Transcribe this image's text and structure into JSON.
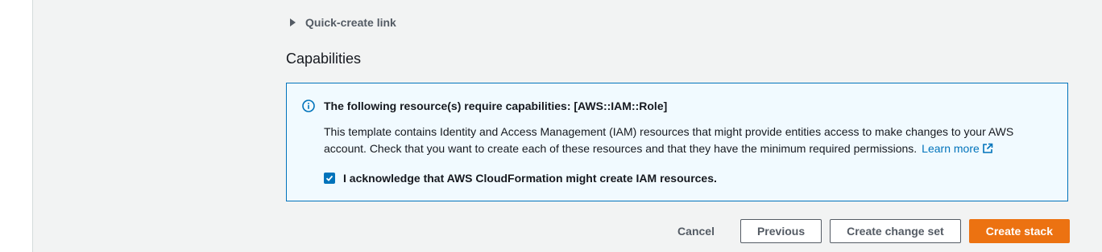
{
  "quick_create": {
    "label": "Quick-create link"
  },
  "capabilities": {
    "title": "Capabilities",
    "alert": {
      "icon": "info-icon",
      "title": "The following resource(s) require capabilities: [AWS::IAM::Role]",
      "body": "This template contains Identity and Access Management (IAM) resources that might provide entities access to make changes to your AWS account. Check that you want to create each of these resources and that they have the minimum required permissions.",
      "learn_more": "Learn more",
      "acknowledge_label": "I acknowledge that AWS CloudFormation might create IAM resources.",
      "acknowledge_checked": true
    }
  },
  "actions": {
    "cancel": "Cancel",
    "previous": "Previous",
    "create_change_set": "Create change set",
    "create_stack": "Create stack"
  },
  "colors": {
    "primary": "#ec7211",
    "link": "#0073bb",
    "alert_bg": "#f1faff",
    "page_bg": "#f2f3f3"
  }
}
